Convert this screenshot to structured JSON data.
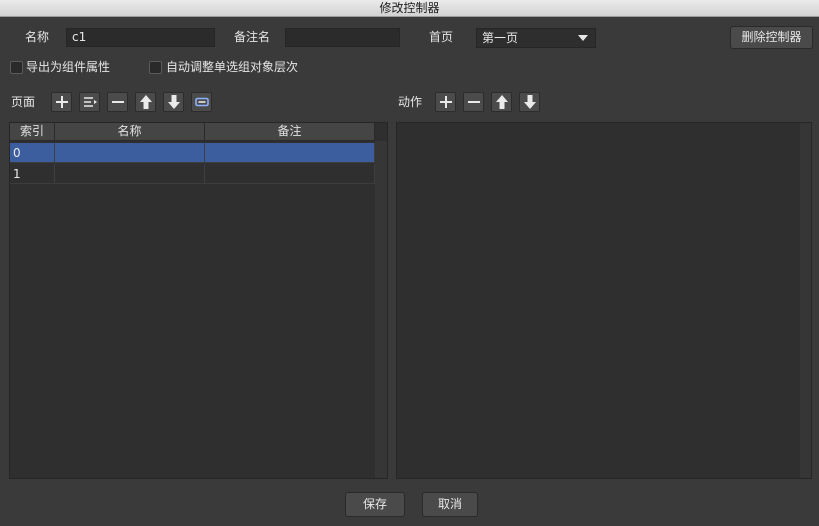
{
  "window": {
    "title": "修改控制器"
  },
  "form": {
    "name_label": "名称",
    "name_value": "c1",
    "remark_label": "备注名",
    "remark_value": "",
    "home_label": "首页",
    "home_value": "第一页",
    "delete_button": "删除控制器",
    "export_checkbox": {
      "label": "导出为组件属性",
      "checked": false
    },
    "autoadjust_checkbox": {
      "label": "自动调整单选组对象层次",
      "checked": false
    }
  },
  "pages": {
    "label": "页面",
    "tools": [
      "plus-icon",
      "insert-list-icon",
      "minus-icon",
      "arrow-up-icon",
      "arrow-down-icon",
      "rename-icon"
    ],
    "columns": [
      "索引",
      "名称",
      "备注"
    ],
    "rows": [
      {
        "index": "0",
        "name": "",
        "remark": "",
        "selected": true
      },
      {
        "index": "1",
        "name": "",
        "remark": "",
        "selected": false
      }
    ]
  },
  "actions": {
    "label": "动作",
    "tools": [
      "plus-icon",
      "minus-icon",
      "arrow-up-icon",
      "arrow-down-icon"
    ]
  },
  "footer": {
    "save": "保存",
    "cancel": "取消"
  }
}
